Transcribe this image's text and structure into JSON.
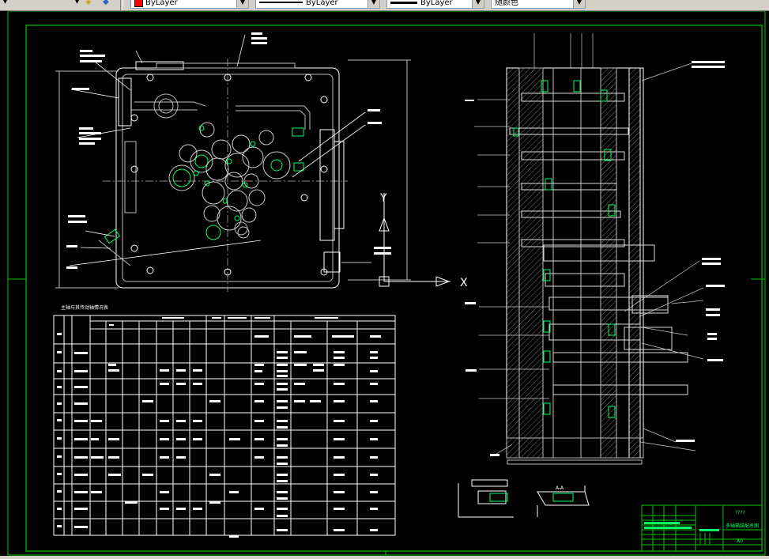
{
  "toolbar": {
    "layer_color_value": "ByLayer",
    "linetype_value": "ByLayer",
    "lineweight_value": "ByLayer",
    "plotstyle_value": "随颜色",
    "color_swatch": "#ff0000"
  },
  "drawing": {
    "background": "#000000",
    "border_color": "#00c800",
    "line_color": "#ffffff",
    "accent_color": "#00ff66",
    "axis_y_label": "Y",
    "axis_x_label": "X",
    "table_title": "主轴与其传动轴情况表",
    "section_label": "A-A",
    "title_block_question": "????",
    "title_block_name": "多轴箱装配总图",
    "title_block_size": "A0"
  }
}
